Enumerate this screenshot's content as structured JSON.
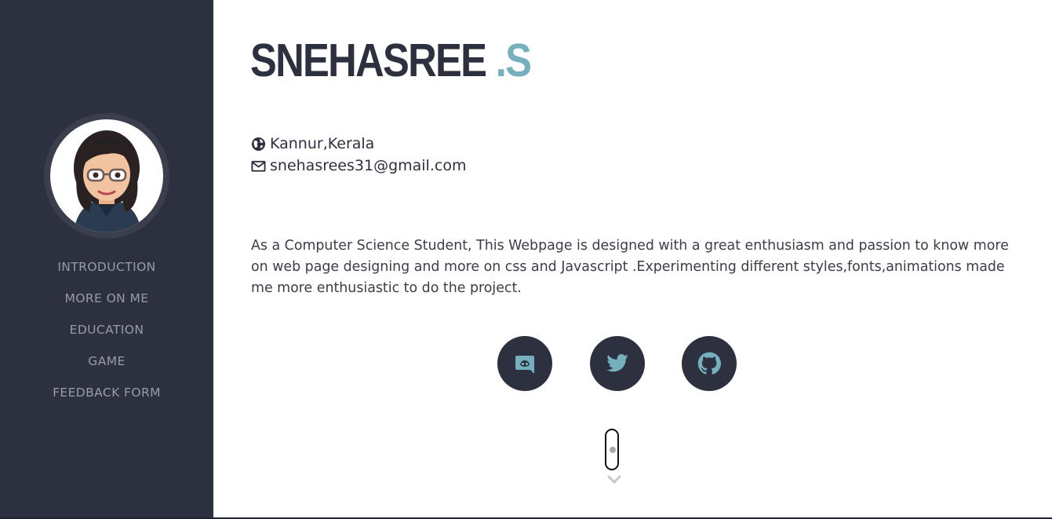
{
  "sidebar": {
    "avatar_icon": "bitmoji-avatar",
    "items": [
      {
        "label": "INTRODUCTION"
      },
      {
        "label": "MORE ON ME"
      },
      {
        "label": "EDUCATION"
      },
      {
        "label": "GAME"
      },
      {
        "label": "FEEDBACK FORM"
      }
    ]
  },
  "header": {
    "name": "SNEHASREE",
    "initial": ".S"
  },
  "contact": {
    "location_icon": "globe-icon",
    "location": "Kannur,Kerala",
    "email_icon": "envelope-icon",
    "email": "snehasrees31@gmail.com"
  },
  "about": "As a Computer Science Student, This Webpage is designed with a great enthusiasm and passion to know more on web page designing and more on css and Javascript .Experimenting different styles,fonts,animations made me more enthusiastic to do the project.",
  "social": [
    {
      "icon": "discord-icon"
    },
    {
      "icon": "twitter-icon"
    },
    {
      "icon": "github-icon"
    }
  ],
  "scroll_indicator": {
    "icon": "mouse-scroll-icon",
    "arrow_icon": "chevron-down-icon"
  },
  "colors": {
    "sidebar_bg": "#2d303e",
    "nav_text": "#9a9ca5",
    "accent": "#76afbe",
    "text": "#2d303e"
  }
}
